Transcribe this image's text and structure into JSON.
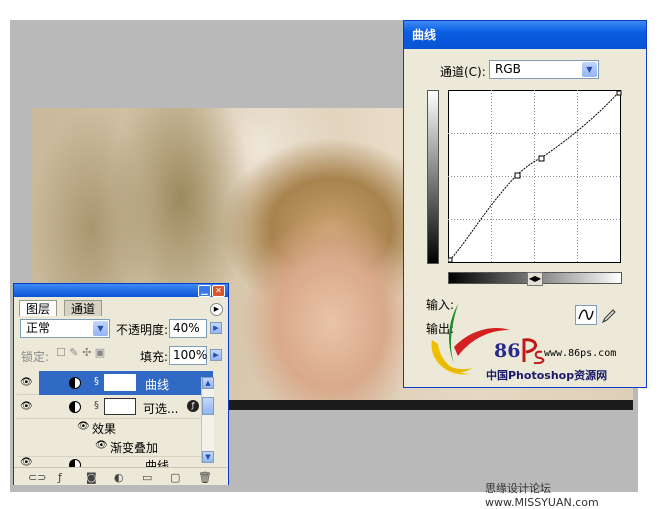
{
  "curves_dialog": {
    "title": "曲线",
    "channel_label": "通道(C):",
    "channel_value": "RGB",
    "input_label": "输入:",
    "output_label": "输出:"
  },
  "logo": {
    "number": "86",
    "url": "www.86ps.com",
    "site_name": "中国Photoshop资源网"
  },
  "layers_panel": {
    "tabs": [
      "图层",
      "通道"
    ],
    "blend_mode": "正常",
    "opacity_label": "不透明度:",
    "opacity_value": "40%",
    "lock_label": "锁定:",
    "fill_label": "填充:",
    "fill_value": "100%",
    "layers": [
      {
        "name": "曲线",
        "selected": true
      },
      {
        "name": "可选...",
        "selected": false
      },
      {
        "name": "效果",
        "selected": false
      },
      {
        "name": "渐变叠加",
        "selected": false
      },
      {
        "name": "曲线",
        "selected": false
      }
    ]
  },
  "watermark": "思缘设计论坛  www.MISSYUAN.com",
  "colors": {
    "title_bar": "#0a53d6",
    "selection": "#316ac5",
    "dialog_bg": "#ece9d8"
  }
}
